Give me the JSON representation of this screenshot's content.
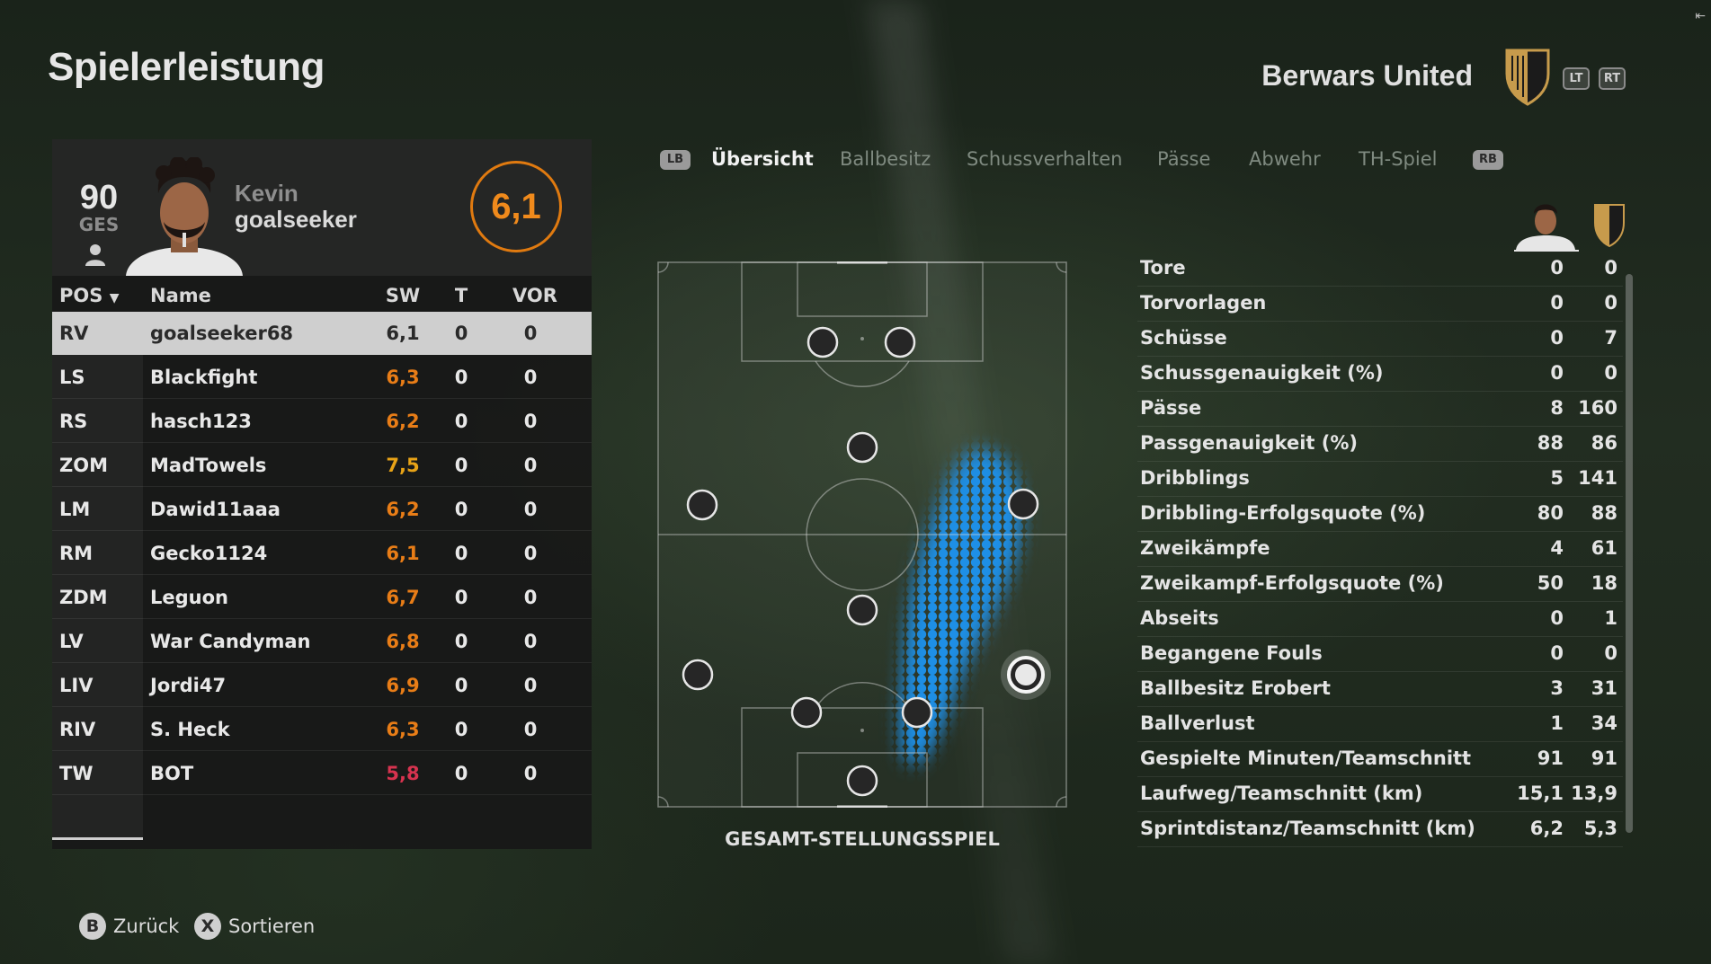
{
  "page_title": "Spielerleistung",
  "club_name": "Berwars United",
  "triggers": [
    "LT",
    "RT"
  ],
  "player": {
    "overall": "90",
    "overall_label": "GES",
    "first_name": "Kevin",
    "last_name": "goalseeker",
    "rating": "6,1"
  },
  "table": {
    "headers": {
      "pos": "POS",
      "name": "Name",
      "sw": "SW",
      "t": "T",
      "vor": "VOR"
    },
    "rows": [
      {
        "pos": "RV",
        "name": "goalseeker68",
        "sw": "6,1",
        "t": "0",
        "vor": "0",
        "sw_color": "#2a2a2a"
      },
      {
        "pos": "LS",
        "name": "Blackfight",
        "sw": "6,3",
        "t": "0",
        "vor": "0",
        "sw_color": "#e87d17"
      },
      {
        "pos": "RS",
        "name": "hasch123",
        "sw": "6,2",
        "t": "0",
        "vor": "0",
        "sw_color": "#e87d17"
      },
      {
        "pos": "ZOM",
        "name": "MadTowels",
        "sw": "7,5",
        "t": "0",
        "vor": "0",
        "sw_color": "#e8a317"
      },
      {
        "pos": "LM",
        "name": "Dawid11aaa",
        "sw": "6,2",
        "t": "0",
        "vor": "0",
        "sw_color": "#e87d17"
      },
      {
        "pos": "RM",
        "name": "Gecko1124",
        "sw": "6,1",
        "t": "0",
        "vor": "0",
        "sw_color": "#e87d17"
      },
      {
        "pos": "ZDM",
        "name": "Leguon",
        "sw": "6,7",
        "t": "0",
        "vor": "0",
        "sw_color": "#e87d17"
      },
      {
        "pos": "LV",
        "name": "War Candyman",
        "sw": "6,8",
        "t": "0",
        "vor": "0",
        "sw_color": "#e87d17"
      },
      {
        "pos": "LIV",
        "name": "Jordi47",
        "sw": "6,9",
        "t": "0",
        "vor": "0",
        "sw_color": "#e87d17"
      },
      {
        "pos": "RIV",
        "name": "S. Heck",
        "sw": "6,3",
        "t": "0",
        "vor": "0",
        "sw_color": "#e87d17"
      },
      {
        "pos": "TW",
        "name": "BOT",
        "sw": "5,8",
        "t": "0",
        "vor": "0",
        "sw_color": "#d6334f"
      }
    ]
  },
  "tabs": {
    "lb": "LB",
    "rb": "RB",
    "items": [
      "Übersicht",
      "Ballbesitz",
      "Schussverhalten",
      "Pässe",
      "Abwehr",
      "TH-Spiel"
    ],
    "active": "Übersicht"
  },
  "pitch_caption": "GESAMT-STELLUNGSSPIEL",
  "stats": [
    {
      "label": "Tore",
      "player": "0",
      "team": "0"
    },
    {
      "label": "Torvorlagen",
      "player": "0",
      "team": "0"
    },
    {
      "label": "Schüsse",
      "player": "0",
      "team": "7"
    },
    {
      "label": "Schussgenauigkeit (%)",
      "player": "0",
      "team": "0"
    },
    {
      "label": "Pässe",
      "player": "8",
      "team": "160"
    },
    {
      "label": "Passgenauigkeit (%)",
      "player": "88",
      "team": "86"
    },
    {
      "label": "Dribblings",
      "player": "5",
      "team": "141"
    },
    {
      "label": "Dribbling-Erfolgsquote (%)",
      "player": "80",
      "team": "88"
    },
    {
      "label": "Zweikämpfe",
      "player": "4",
      "team": "61"
    },
    {
      "label": "Zweikampf-Erfolgsquote (%)",
      "player": "50",
      "team": "18"
    },
    {
      "label": "Abseits",
      "player": "0",
      "team": "1"
    },
    {
      "label": "Begangene Fouls",
      "player": "0",
      "team": "0"
    },
    {
      "label": "Ballbesitz Erobert",
      "player": "3",
      "team": "31"
    },
    {
      "label": "Ballverlust",
      "player": "1",
      "team": "34"
    },
    {
      "label": "Gespielte Minuten/Teamschnitt",
      "player": "91",
      "team": "91"
    },
    {
      "label": "Laufweg/Teamschnitt (km)",
      "player": "15,1",
      "team": "13,9"
    },
    {
      "label": "Sprintdistanz/Teamschnitt (km)",
      "player": "6,2",
      "team": "5,3"
    }
  ],
  "footer": {
    "back_glyph": "B",
    "back_label": "Zurück",
    "sort_glyph": "X",
    "sort_label": "Sortieren"
  },
  "colors": {
    "accent_orange": "#e87d17",
    "heatmap_blue": "#1e8fe6",
    "low_rating_red": "#d6334f"
  }
}
